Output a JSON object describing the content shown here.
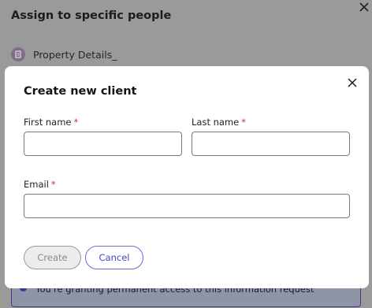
{
  "background": {
    "title": "Assign to specific people",
    "item_label": "Property Details_",
    "notice_text": "You're granting permanent access to this information request"
  },
  "modal": {
    "title": "Create new client",
    "first_name_label": "First name",
    "last_name_label": "Last name",
    "email_label": "Email",
    "required_mark": "*",
    "first_name_value": "",
    "last_name_value": "",
    "email_value": "",
    "create_label": "Create",
    "cancel_label": "Cancel"
  },
  "colors": {
    "accent": "#4a47c8",
    "required": "#d0312d",
    "overlay": "#999a99"
  },
  "icons": {
    "close": "close-icon",
    "document": "document-icon",
    "info": "info-icon"
  }
}
